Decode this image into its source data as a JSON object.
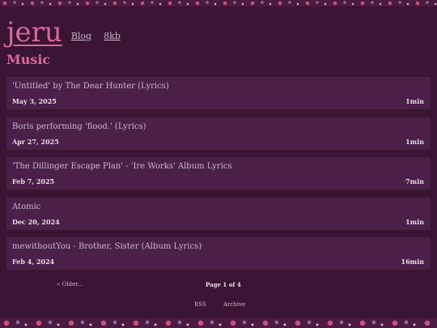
{
  "site": {
    "logo": "jeru",
    "nav": [
      "Blog",
      "8kb"
    ]
  },
  "section": {
    "title": "Music"
  },
  "posts": [
    {
      "title": "'Untitled' by The Dear Hunter (Lyrics)",
      "date": "May 3, 2025",
      "read_time": "1min"
    },
    {
      "title": "Boris performing 'flood.' (Lyrics)",
      "date": "Apr 27, 2025",
      "read_time": "1min"
    },
    {
      "title": "'The Dillinger Escape Plan' - 'Ire Works' Album Lyrics",
      "date": "Feb 7, 2025",
      "read_time": "7min"
    },
    {
      "title": "Atomic",
      "date": "Dec 20, 2024",
      "read_time": "1min"
    },
    {
      "title": "mewithoutYou - Brother, Sister (Album Lyrics)",
      "date": "Feb 4, 2024",
      "read_time": "16min"
    }
  ],
  "pagination": {
    "older": "« Older...",
    "page": "Page 1 of 4"
  },
  "footer": {
    "rss": "RSS",
    "archive": "Archive"
  },
  "colors": {
    "background": "#3a1433",
    "accent": "#d9699b",
    "card": "#4a1f48"
  }
}
